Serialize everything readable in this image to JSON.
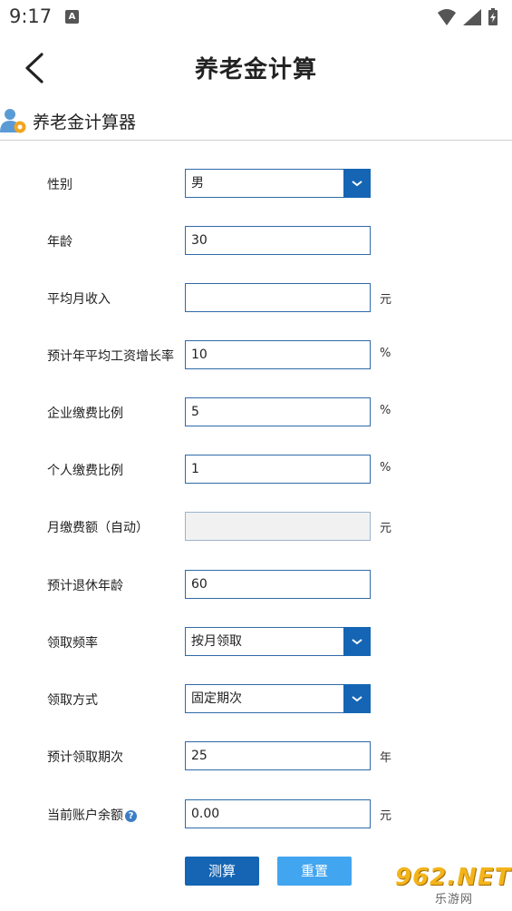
{
  "status": {
    "time": "9:17",
    "badge": "A"
  },
  "appbar": {
    "title": "养老金计算"
  },
  "section": {
    "title": "养老金计算器"
  },
  "form": {
    "gender": {
      "label": "性别",
      "value": "男"
    },
    "age": {
      "label": "年龄",
      "value": "30"
    },
    "monthly_income": {
      "label": "平均月收入",
      "value": "",
      "unit": "元"
    },
    "wage_growth": {
      "label": "预计年平均工资增长率",
      "value": "10",
      "unit": "%"
    },
    "company_rate": {
      "label": "企业缴费比例",
      "value": "5",
      "unit": "%"
    },
    "personal_rate": {
      "label": "个人缴费比例",
      "value": "1",
      "unit": "%"
    },
    "monthly_payment": {
      "label": "月缴费额（自动）",
      "value": "",
      "unit": "元"
    },
    "retire_age": {
      "label": "预计退休年龄",
      "value": "60"
    },
    "frequency": {
      "label": "领取频率",
      "value": "按月领取"
    },
    "method": {
      "label": "领取方式",
      "value": "固定期次"
    },
    "periods": {
      "label": "预计领取期次",
      "value": "25",
      "unit": "年"
    },
    "balance": {
      "label": "当前账户余额",
      "value": "0.00",
      "unit": "元",
      "help": "?"
    }
  },
  "buttons": {
    "calculate": "测算",
    "reset": "重置"
  },
  "watermark": {
    "main": "962.NET",
    "sub": "乐游网"
  },
  "colors": {
    "accent": "#1565b4",
    "reset": "#42a5f0",
    "border": "#2f6aa8"
  }
}
